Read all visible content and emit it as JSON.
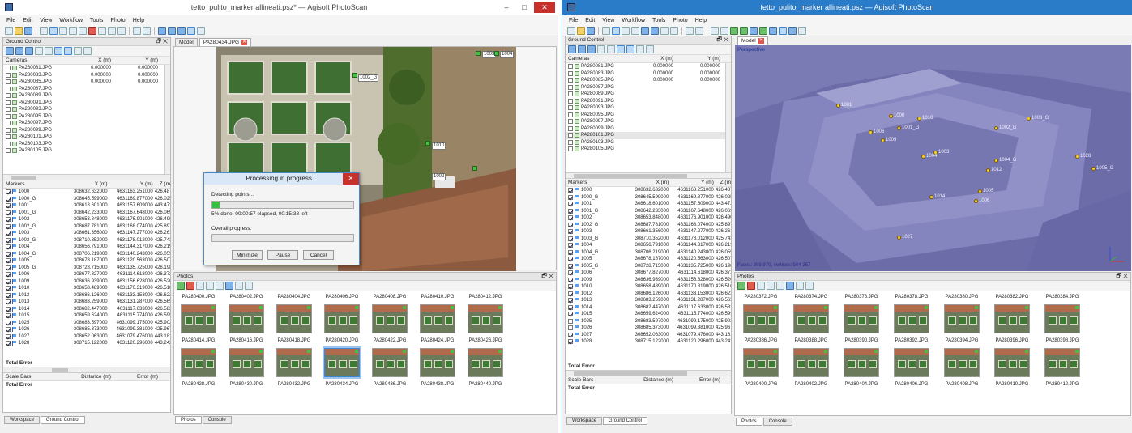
{
  "left": {
    "title": "tetto_pulito_marker allineati.psz* — Agisoft PhotoScan",
    "menu": [
      "File",
      "Edit",
      "View",
      "Workflow",
      "Tools",
      "Photo",
      "Help"
    ],
    "ground_control": {
      "title": "Ground Control",
      "cam_headers": [
        "Cameras",
        "X (m)",
        "Y (m)"
      ],
      "cameras": [
        {
          "name": "PA280081.JPG",
          "x": "0.000000",
          "y": "0.000000"
        },
        {
          "name": "PA280083.JPG",
          "x": "0.000000",
          "y": "0.000000"
        },
        {
          "name": "PA280085.JPG",
          "x": "0.000000",
          "y": "0.000000"
        },
        {
          "name": "PA280087.JPG",
          "x": "",
          "y": ""
        },
        {
          "name": "PA280089.JPG",
          "x": "",
          "y": ""
        },
        {
          "name": "PA280091.JPG",
          "x": "",
          "y": ""
        },
        {
          "name": "PA280093.JPG",
          "x": "",
          "y": ""
        },
        {
          "name": "PA280095.JPG",
          "x": "",
          "y": ""
        },
        {
          "name": "PA280097.JPG",
          "x": "",
          "y": ""
        },
        {
          "name": "PA280099.JPG",
          "x": "",
          "y": ""
        },
        {
          "name": "PA280101.JPG",
          "x": "",
          "y": ""
        },
        {
          "name": "PA280103.JPG",
          "x": "",
          "y": ""
        },
        {
          "name": "PA280105.JPG",
          "x": "",
          "y": ""
        }
      ],
      "marker_headers": [
        "Markers",
        "X (m)",
        "Y (m)",
        "Z (m"
      ],
      "markers": [
        {
          "name": "1000",
          "x": "308632.632000",
          "y": "4631163.251000",
          "z": "426.4870"
        },
        {
          "name": "1000_G",
          "x": "308645.599000",
          "y": "4631169.877000",
          "z": "426.0250"
        },
        {
          "name": "1001",
          "x": "308618.601000",
          "y": "4631157.609000",
          "z": "443.4720"
        },
        {
          "name": "1001_G",
          "x": "308642.233000",
          "y": "4631167.648000",
          "z": "426.0690"
        },
        {
          "name": "1002",
          "x": "308653.848000",
          "y": "4631176.901000",
          "z": "426.4900"
        },
        {
          "name": "1002_G",
          "x": "308687.781000",
          "y": "4631168.074000",
          "z": "425.8970"
        },
        {
          "name": "1003",
          "x": "308661.356000",
          "y": "4631147.277000",
          "z": "426.2610"
        },
        {
          "name": "1003_G",
          "x": "308710.352000",
          "y": "4631178.012000",
          "z": "425.7430"
        },
        {
          "name": "1004",
          "x": "308656.791000",
          "y": "4631144.317000",
          "z": "426.2190"
        },
        {
          "name": "1004_G",
          "x": "308706.219000",
          "y": "4631140.243000",
          "z": "426.0590"
        },
        {
          "name": "1005",
          "x": "308678.187000",
          "y": "4631120.563000",
          "z": "426.5070"
        },
        {
          "name": "1005_G",
          "x": "308728.715000",
          "y": "4631135.725000",
          "z": "426.1980"
        },
        {
          "name": "1006",
          "x": "308677.827000",
          "y": "4631114.618000",
          "z": "426.3720"
        },
        {
          "name": "1009",
          "x": "308636.939000",
          "y": "4631156.628000",
          "z": "426.5200"
        },
        {
          "name": "1010",
          "x": "308658.489000",
          "y": "4631170.319000",
          "z": "426.5100"
        },
        {
          "name": "1012",
          "x": "308686.126000",
          "y": "4631133.153000",
          "z": "426.6220"
        },
        {
          "name": "1013",
          "x": "308683.259000",
          "y": "4631131.287000",
          "z": "426.5650"
        },
        {
          "name": "1014",
          "x": "308682.447000",
          "y": "4631117.633000",
          "z": "426.5820"
        },
        {
          "name": "1015",
          "x": "308659.624000",
          "y": "4631115.774000",
          "z": "426.5990"
        },
        {
          "name": "1025",
          "x": "308683.597000",
          "y": "4631099.175000",
          "z": "425.9020"
        },
        {
          "name": "1026",
          "x": "308685.373000",
          "y": "4631099.381000",
          "z": "425.9670"
        },
        {
          "name": "1027",
          "x": "308652.063000",
          "y": "4631079.476000",
          "z": "443.1810"
        },
        {
          "name": "1028",
          "x": "308715.122000",
          "y": "4631120.296000",
          "z": "443.2420"
        }
      ],
      "total_error": "Total Error",
      "scale_headers": [
        "Scale Bars",
        "Distance (m)",
        "Error (m)"
      ],
      "scale_total": "Total Error"
    },
    "bottom_tabs": [
      "Workspace",
      "Ground Control"
    ],
    "doc_tabs": [
      "Model",
      "PA280434.JPG"
    ],
    "image_markers": [
      "1003",
      "1004",
      "1002_G",
      "1010",
      "1002"
    ],
    "dialog": {
      "title": "Processing in progress...",
      "stage": "Detecting points...",
      "status": "5% done, 00:00:57 elapsed, 00:15:38 left",
      "progress": 0.05,
      "overall_label": "Overall progress:",
      "overall_progress": 0.0,
      "buttons": [
        "Minimize",
        "Pause",
        "Cancel"
      ]
    },
    "photos": {
      "title": "Photos",
      "row1": [
        "PA280400.JPG",
        "PA280402.JPG",
        "PA280404.JPG",
        "PA280406.JPG",
        "PA280408.JPG",
        "PA280410.JPG",
        "PA280412.JPG"
      ],
      "row2": [
        "PA280414.JPG",
        "PA280416.JPG",
        "PA280418.JPG",
        "PA280420.JPG",
        "PA280422.JPG",
        "PA280424.JPG",
        "PA280426.JPG"
      ],
      "row3": [
        "PA280428.JPG",
        "PA280430.JPG",
        "PA280432.JPG",
        "PA280434.JPG",
        "PA280436.JPG",
        "PA280438.JPG",
        "PA280440.JPG"
      ]
    },
    "photo_tabs": [
      "Photos",
      "Console"
    ]
  },
  "right": {
    "title": "tetto_pulito_marker allineati.psz — Agisoft PhotoScan",
    "menu": [
      "File",
      "Edit",
      "View",
      "Workflow",
      "Tools",
      "Photo",
      "Help"
    ],
    "doc_tabs": [
      "Model"
    ],
    "view_mode": "Perspective",
    "stats_text": "Faces: 999 970, vertices: 504 257",
    "model_markers": [
      {
        "label": "1001"
      },
      {
        "label": "1000"
      },
      {
        "label": "1010"
      },
      {
        "label": "1006"
      },
      {
        "label": "1001_G"
      },
      {
        "label": "1009"
      },
      {
        "label": "1002_G"
      },
      {
        "label": "1003_G"
      },
      {
        "label": "1003"
      },
      {
        "label": "1004"
      },
      {
        "label": "1004_G"
      },
      {
        "label": "1028"
      },
      {
        "label": "1005_G"
      },
      {
        "label": "1012"
      },
      {
        "label": "1005"
      },
      {
        "label": "1014"
      },
      {
        "label": "1006"
      },
      {
        "label": "1027"
      }
    ],
    "photos": {
      "title": "Photos",
      "row1": [
        "PA280372.JPG",
        "PA280374.JPG",
        "PA280376.JPG",
        "PA280378.JPG",
        "PA280380.JPG",
        "PA280382.JPG",
        "PA280384.JPG"
      ],
      "row2": [
        "PA280386.JPG",
        "PA280388.JPG",
        "PA280390.JPG",
        "PA280392.JPG",
        "PA280394.JPG",
        "PA280396.JPG",
        "PA280398.JPG"
      ],
      "row3": [
        "PA280400.JPG",
        "PA280402.JPG",
        "PA280404.JPG",
        "PA280406.JPG",
        "PA280408.JPG",
        "PA280410.JPG",
        "PA280412.JPG"
      ]
    },
    "photo_tabs": [
      "Photos",
      "Console"
    ]
  }
}
